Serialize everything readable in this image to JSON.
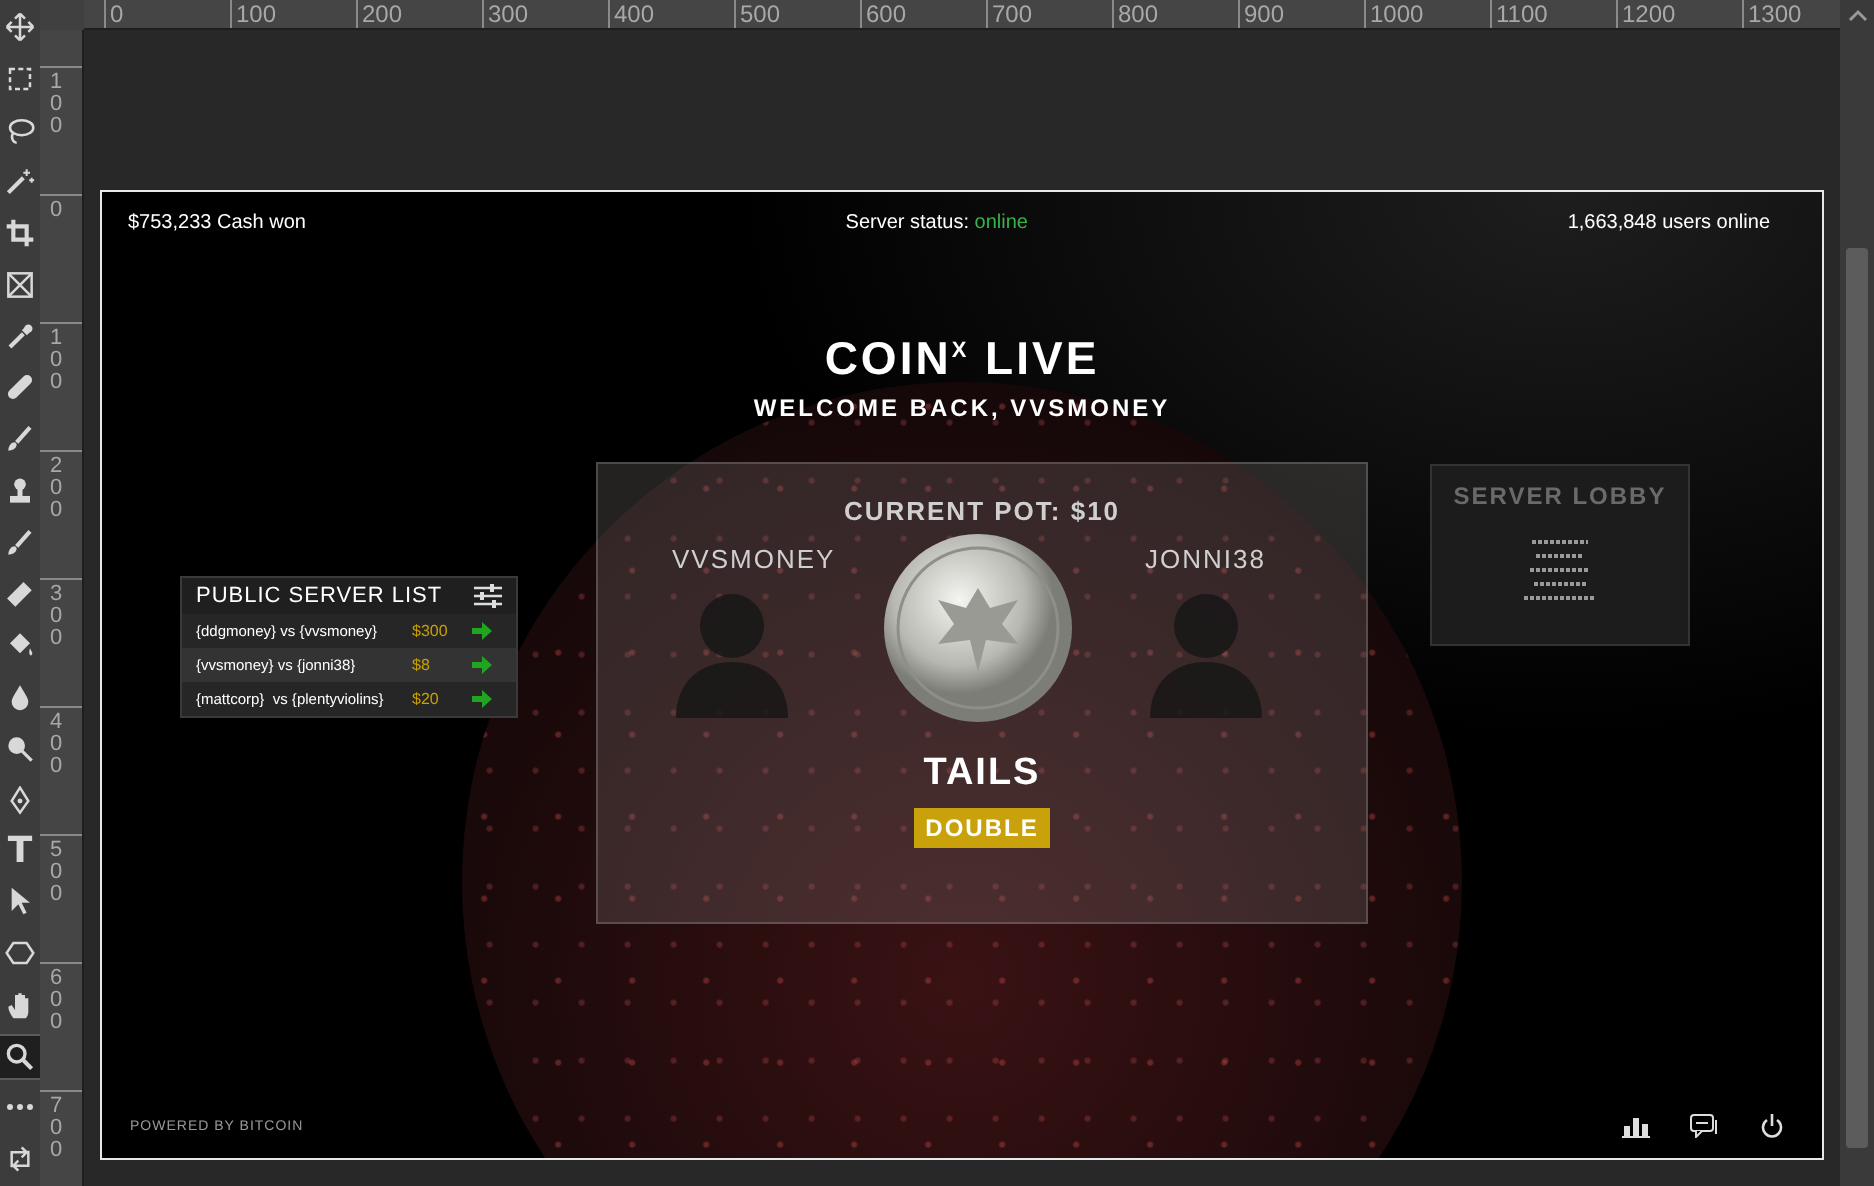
{
  "toolbar": {
    "tools": [
      {
        "kind": "move",
        "selected": false
      },
      {
        "kind": "marquee",
        "selected": false
      },
      {
        "kind": "lasso",
        "selected": false
      },
      {
        "kind": "wand",
        "selected": false
      },
      {
        "kind": "crop",
        "selected": false
      },
      {
        "kind": "frame",
        "selected": false
      },
      {
        "kind": "eyedropper",
        "selected": false
      },
      {
        "kind": "healing",
        "selected": false
      },
      {
        "kind": "brush",
        "selected": false
      },
      {
        "kind": "stamp",
        "selected": false
      },
      {
        "kind": "history",
        "selected": false
      },
      {
        "kind": "eraser",
        "selected": false
      },
      {
        "kind": "bucket",
        "selected": false
      },
      {
        "kind": "blur",
        "selected": false
      },
      {
        "kind": "dodge",
        "selected": false
      },
      {
        "kind": "pen",
        "selected": false
      },
      {
        "kind": "type",
        "glyph": "T",
        "selected": false
      },
      {
        "kind": "select",
        "selected": false
      },
      {
        "kind": "shape",
        "selected": false
      },
      {
        "kind": "hand",
        "selected": false
      },
      {
        "kind": "zoom",
        "selected": true
      },
      {
        "kind": "more",
        "selected": false
      },
      {
        "kind": "swap",
        "selected": false
      }
    ]
  },
  "top_ruler": [
    "0",
    "100",
    "200",
    "300",
    "400",
    "500",
    "600",
    "700",
    "800",
    "900",
    "1000",
    "1100",
    "1200",
    "1300"
  ],
  "left_ruler": [
    "100",
    "0",
    "100",
    "200",
    "300",
    "400",
    "500",
    "600",
    "700"
  ],
  "artboard": {
    "cash_won": "$753,233 Cash won",
    "server_status": {
      "label": "Server status:",
      "value": "online"
    },
    "users_online": "1,663,848 users online",
    "title": "COIN$^{X}$ LIVE",
    "subtitle": "WELCOME BACK, VVSMONEY",
    "server_list": {
      "title": "PUBLIC SERVER LIST",
      "rows": [
        {
          "match": "{ddgmoney} vs {vvsmoney}",
          "amount": "$300"
        },
        {
          "match": "{vvsmoney} vs {jonni38}",
          "amount": "$8"
        },
        {
          "match": "{mattcorp}  vs {plentyviolins}",
          "amount": "$20"
        }
      ]
    },
    "game": {
      "pot": "CURRENT POT: $10",
      "player_left": "VVSMONEY",
      "player_right": "JONNI38",
      "result": "TAILS",
      "action": "DOUBLE"
    },
    "lobby": {
      "title": "SERVER LOBBY"
    },
    "footer": "POWERED BY BITCOIN"
  }
}
